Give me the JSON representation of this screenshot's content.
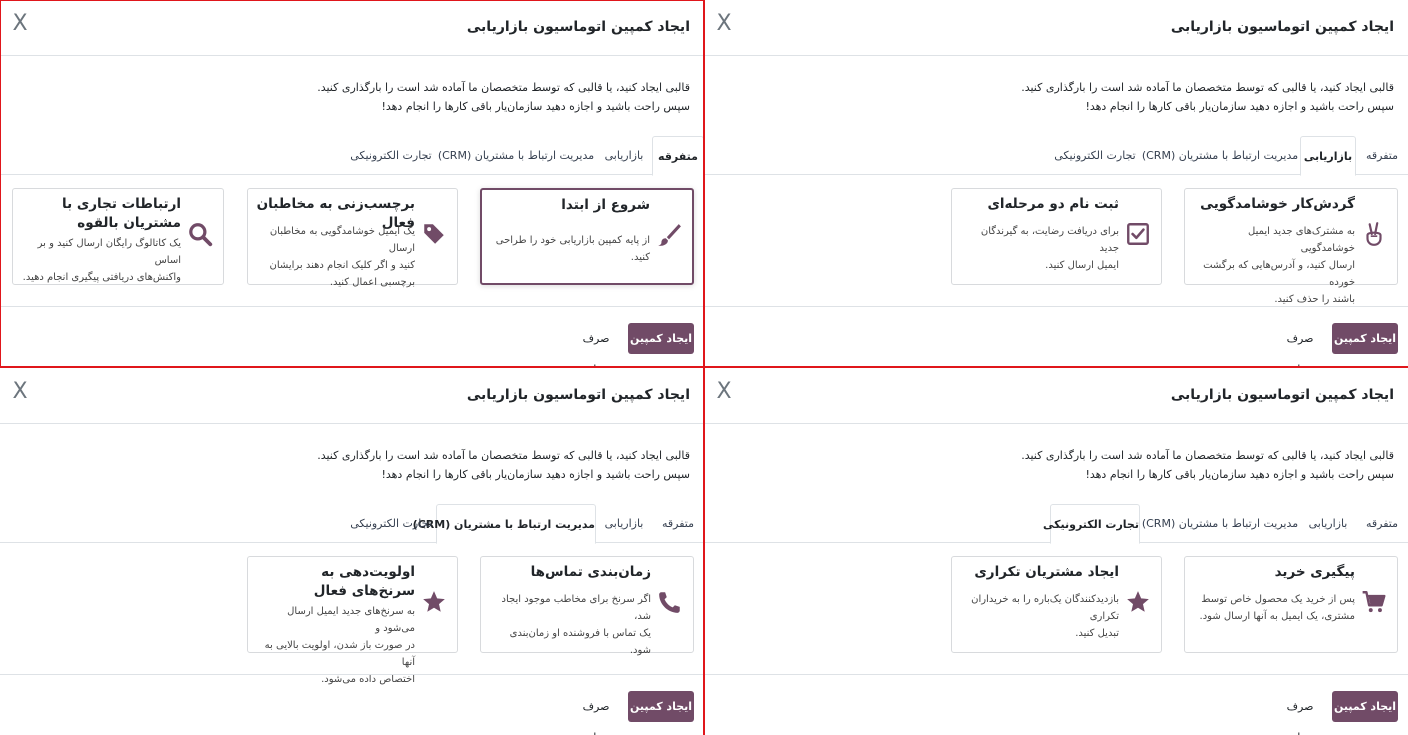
{
  "dialog": {
    "title": "ایجاد کمپین اتوماسیون بازاریابی",
    "description_line1": "قالبی ایجاد کنید، یا قالبی که توسط متخصصان ما آماده شد است را بارگذاری کنید.",
    "description_line2": "سپس راحت باشید و اجازه دهید سازمان‌یار باقی کارها را انجام دهد!",
    "close_label": "X",
    "create_button": "ایجاد کمپین",
    "discard_button": "صرف نظر",
    "tabs": [
      "متفرقه",
      "بازاریابی",
      "مدیریت ارتباط با مشتریان (CRM)",
      "تجارت الکترونیکی"
    ]
  },
  "accent_color": "#714b67",
  "panels": [
    {
      "active_tab": "متفرقه",
      "cards": [
        {
          "title": "شروع از ابتدا",
          "desc": [
            "از پایه کمپین بازاریابی خود را طراحی کنید."
          ],
          "icon": "paint-brush-icon"
        },
        {
          "title": "برچسب‌زنی به مخاطبان فعال",
          "desc": [
            "یک ایمیل خوشامدگویی به مخاطبان ارسال",
            "کنید و اگر کلیک انجام دهند برایشان",
            "برچسبی اعمال کنید."
          ],
          "icon": "tag-icon"
        },
        {
          "title": "ارتباطات تجاری با مشتریان بالقوه",
          "desc": [
            "یک کاتالوگ رایگان ارسال کنید و بر اساس",
            "واکنش‌های دریافتی پیگیری انجام دهید."
          ],
          "icon": "search-icon"
        }
      ]
    },
    {
      "active_tab": "بازاریابی",
      "cards": [
        {
          "title": "گردش‌کار خوشامدگویی",
          "desc": [
            "به مشترک‌های جدید ایمیل خوشامدگویی",
            "ارسال کنید، و آدرس‌هایی که برگشت خورده",
            "باشند را حذف کنید."
          ],
          "icon": "hand-peace-icon"
        },
        {
          "title": "ثبت نام دو مرحله‌ای",
          "desc": [
            "برای دریافت رضایت، به گیرندگان جدید",
            "ایمیل ارسال کنید."
          ],
          "icon": "checkbox-icon"
        }
      ]
    },
    {
      "active_tab": "مدیریت ارتباط با مشتریان (CRM)",
      "cards": [
        {
          "title": "زمان‌بندی تماس‌ها",
          "desc": [
            "اگر سرنخ برای مخاطب موجود ایجاد شد،",
            "یک تماس با فروشنده او زمان‌بندی شود."
          ],
          "icon": "phone-icon"
        },
        {
          "title": "اولویت‌دهی به سرنخ‌های فعال",
          "desc": [
            "به سرنخ‌های جدید ایمیل ارسال می‌شود و",
            "در صورت باز شدن، اولویت بالایی به آنها",
            "اختصاص داده می‌شود."
          ],
          "icon": "star-icon"
        }
      ]
    },
    {
      "active_tab": "تجارت الکترونیکی",
      "cards": [
        {
          "title": "پیگیری خرید",
          "desc": [
            "پس از خرید یک محصول خاص توسط",
            "مشتری، یک ایمیل به آنها ارسال شود."
          ],
          "icon": "cart-icon"
        },
        {
          "title": "ایجاد مشتریان تکراری",
          "desc": [
            "بازدیدکنندگان یک‌باره را به خریداران تکراری",
            "تبدیل کنید."
          ],
          "icon": "star-icon"
        }
      ]
    }
  ]
}
